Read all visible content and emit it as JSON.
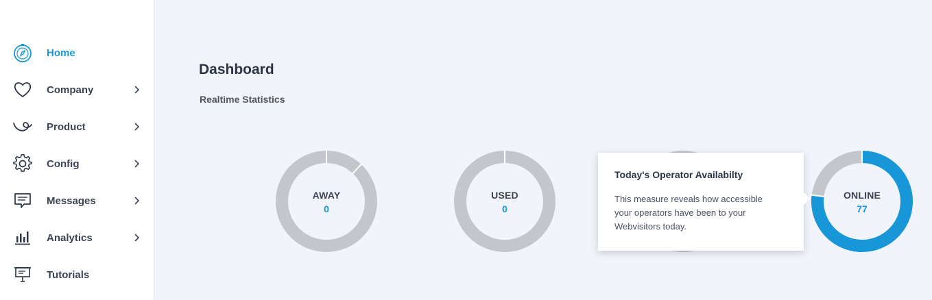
{
  "sidebar": {
    "items": [
      {
        "label": "Home",
        "icon": "compass-icon",
        "active": true,
        "has_submenu": false
      },
      {
        "label": "Company",
        "icon": "heart-icon",
        "active": false,
        "has_submenu": true
      },
      {
        "label": "Product",
        "icon": "product-icon",
        "active": false,
        "has_submenu": true
      },
      {
        "label": "Config",
        "icon": "gear-icon",
        "active": false,
        "has_submenu": true
      },
      {
        "label": "Messages",
        "icon": "message-icon",
        "active": false,
        "has_submenu": true
      },
      {
        "label": "Analytics",
        "icon": "bar-chart-icon",
        "active": false,
        "has_submenu": true
      },
      {
        "label": "Tutorials",
        "icon": "presentation-icon",
        "active": false,
        "has_submenu": false
      }
    ]
  },
  "main": {
    "title": "Dashboard",
    "subtitle": "Realtime Statistics"
  },
  "stats": [
    {
      "label": "AWAY",
      "value": "0",
      "fill_fraction": 0.12,
      "fill_color": "#c3c7cb"
    },
    {
      "label": "USED",
      "value": "0",
      "fill_fraction": 0.0,
      "fill_color": "#c3c7cb"
    },
    {
      "label": "ONLINE",
      "value": "77",
      "fill_fraction": 0.77,
      "fill_color": "#1797d8"
    }
  ],
  "tooltip": {
    "title": "Today's Operator Availabilty",
    "body": "This measure reveals how accessible your operators have been to your Webvisitors today."
  },
  "colors": {
    "accent": "#1797d8",
    "track": "#c3c7cb",
    "background": "#f1f4fa"
  }
}
